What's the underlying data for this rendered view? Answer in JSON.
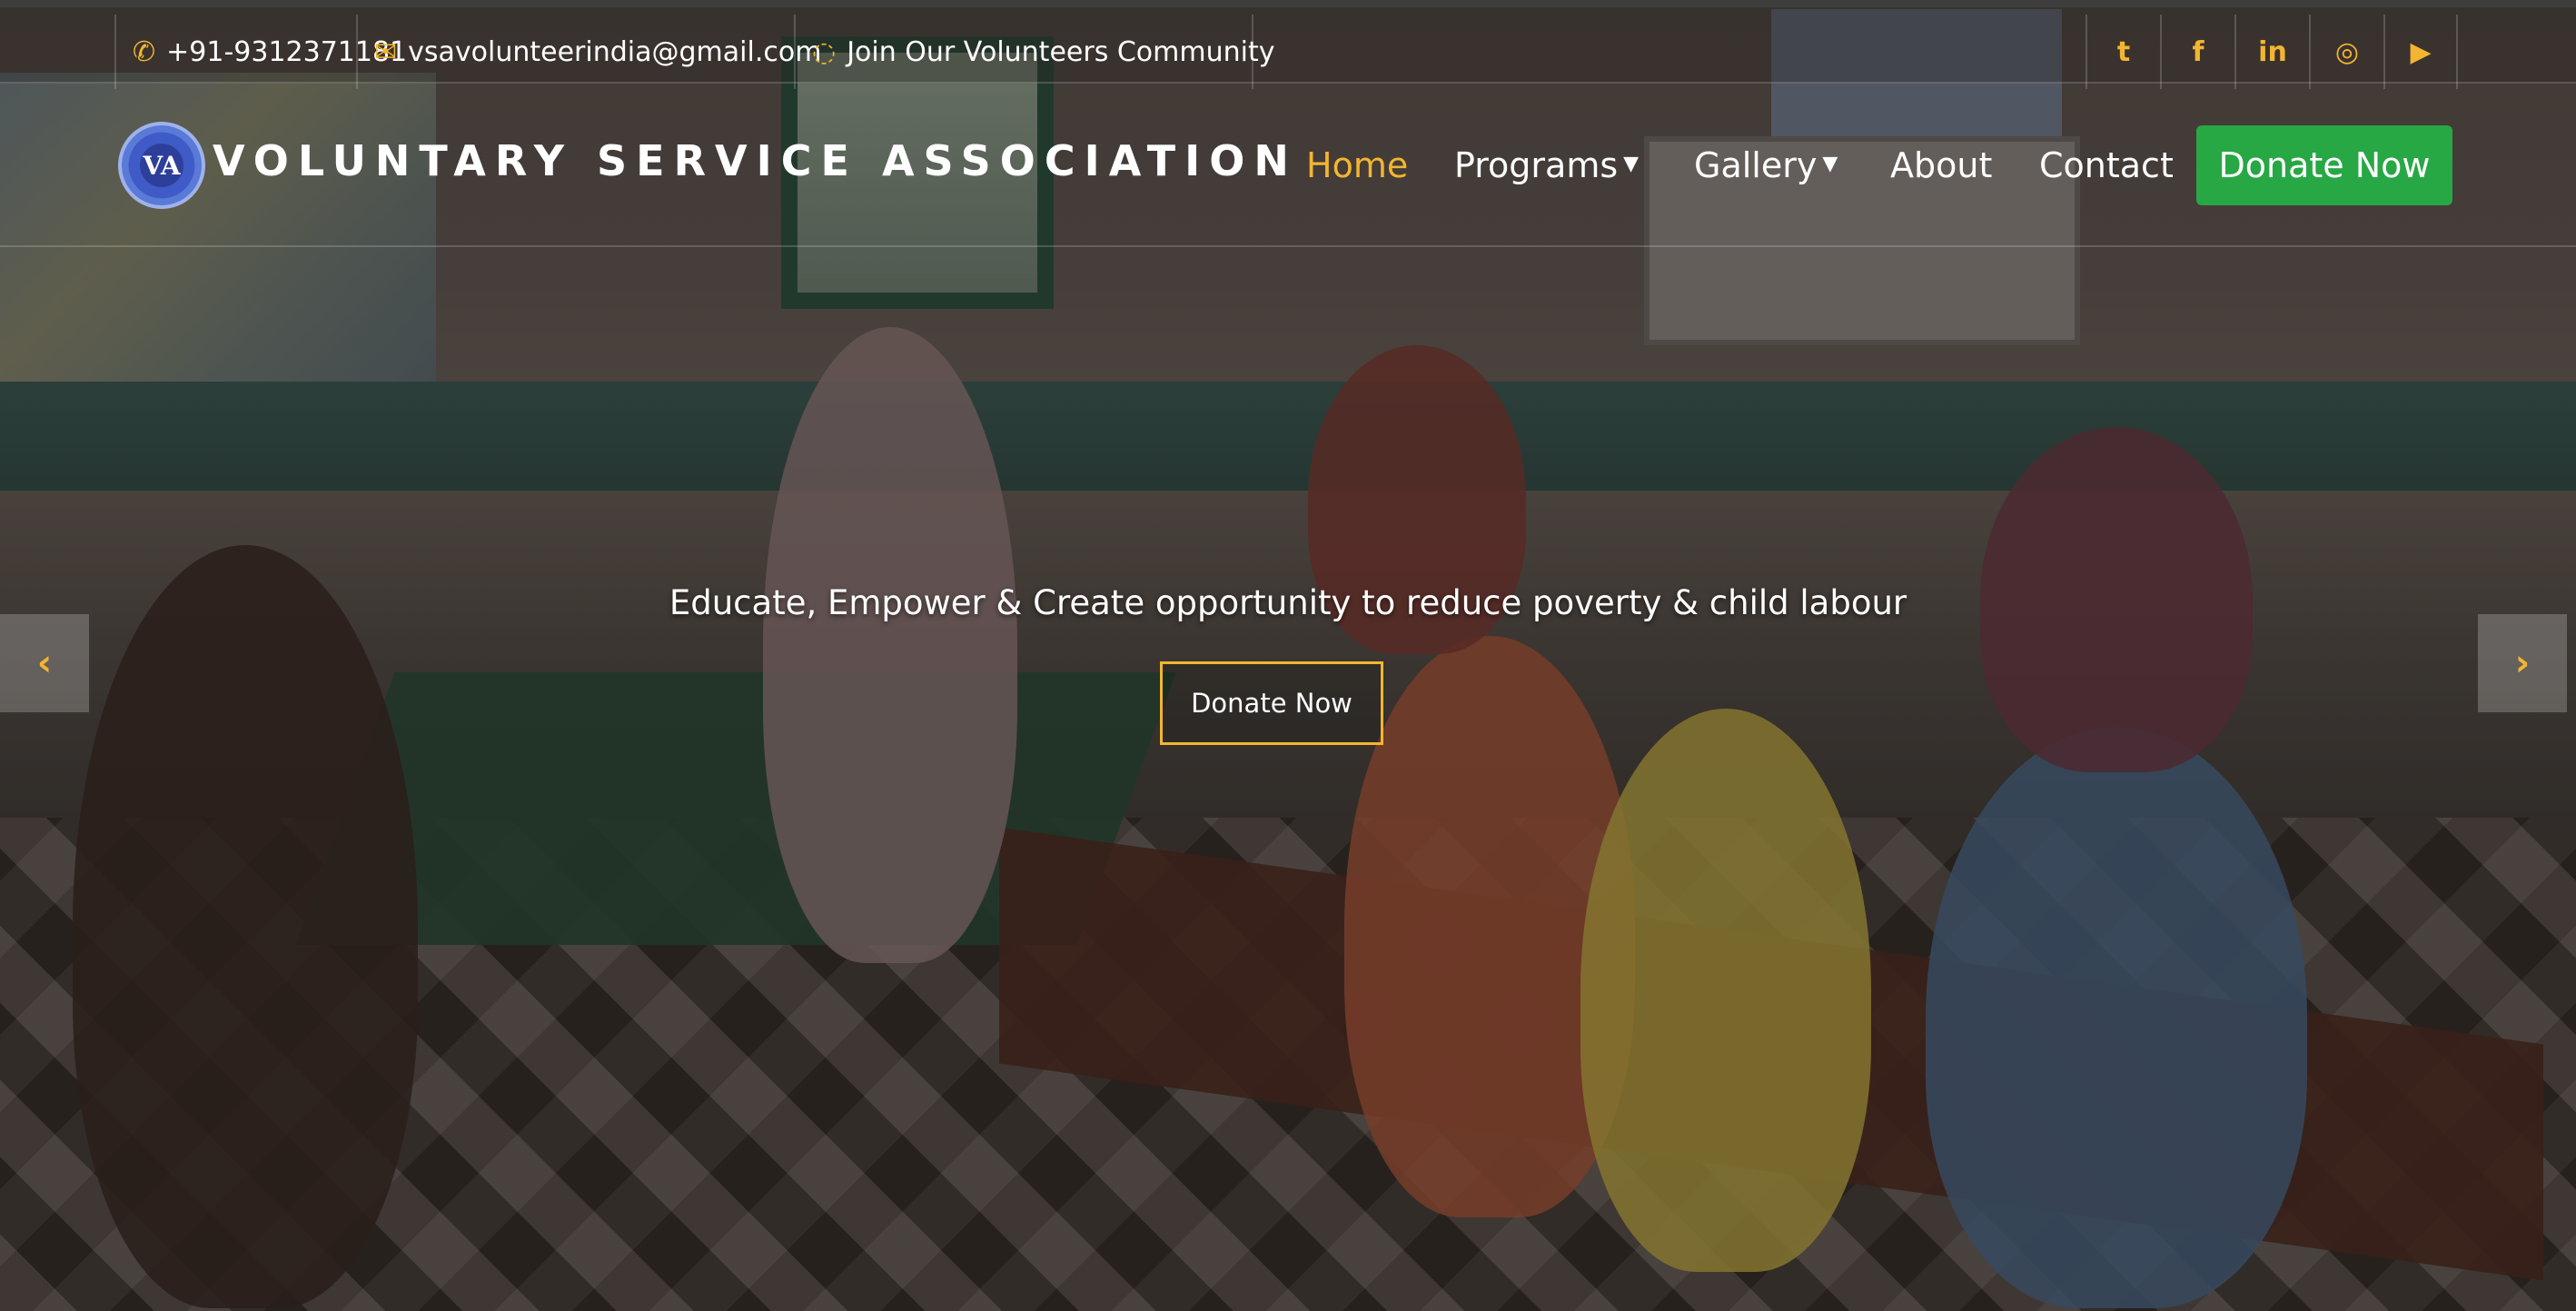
{
  "topbar": {
    "phone": {
      "icon": "phone-icon",
      "text": "+91-9312371181"
    },
    "email": {
      "icon": "envelope-icon",
      "text": "vsavolunteerindia@gmail.com"
    },
    "community": {
      "icon": "whatsapp-icon",
      "text": "Join Our Volunteers Community"
    },
    "social": [
      {
        "icon": "twitter-icon",
        "glyph": "t"
      },
      {
        "icon": "facebook-icon",
        "glyph": "f"
      },
      {
        "icon": "linkedin-icon",
        "glyph": "in"
      },
      {
        "icon": "instagram-icon",
        "glyph": "◎"
      },
      {
        "icon": "youtube-icon",
        "glyph": "▶"
      }
    ]
  },
  "navbar": {
    "logo_text": "VA",
    "brand": "VOLUNTARY SERVICE ASSOCIATION",
    "links": {
      "home": "Home",
      "programs": "Programs",
      "gallery": "Gallery",
      "about": "About",
      "contact": "Contact"
    },
    "donate": "Donate Now"
  },
  "hero": {
    "tagline": "Educate, Empower & Create opportunity to reduce poverty & child labour",
    "donate": "Donate Now",
    "prev_glyph": "‹",
    "next_glyph": "›"
  },
  "colors": {
    "accent": "#f3b531",
    "donate_green": "#28a745"
  }
}
